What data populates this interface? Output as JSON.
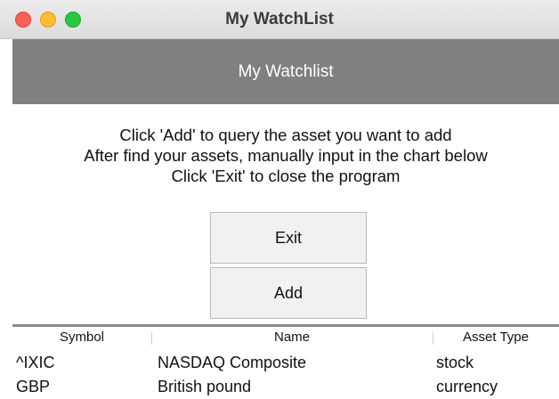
{
  "window": {
    "title": "My WatchList"
  },
  "header": {
    "banner_text": "My Watchlist"
  },
  "instructions": {
    "line1": "Click 'Add' to query the asset you want to add",
    "line2": "After find your assets, manually input in the chart below",
    "line3": "Click 'Exit' to close the program"
  },
  "buttons": {
    "exit_label": "Exit",
    "add_label": "Add"
  },
  "table": {
    "columns": [
      "Symbol",
      "Name",
      "Asset Type"
    ],
    "rows": [
      [
        "^IXIC",
        "NASDAQ Composite",
        "stock"
      ],
      [
        "GBP",
        "British pound",
        "currency"
      ]
    ]
  },
  "colors": {
    "banner_background": "#808080",
    "banner_text": "#ffffff",
    "traffic_close": "#fe5f57",
    "traffic_minimize": "#febc2e",
    "traffic_zoom": "#28c840"
  }
}
